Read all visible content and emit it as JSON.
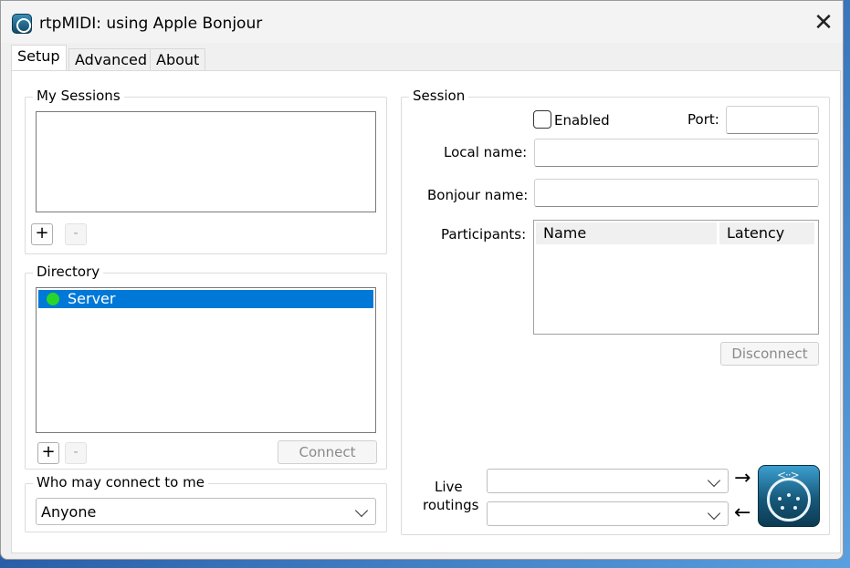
{
  "window": {
    "title": "rtpMIDI: using Apple Bonjour",
    "close_glyph": "✕"
  },
  "tabs": [
    {
      "label": "Setup",
      "active": true
    },
    {
      "label": "Advanced",
      "active": false
    },
    {
      "label": "About",
      "active": false
    }
  ],
  "my_sessions": {
    "title": "My Sessions",
    "items": [],
    "add_label": "+",
    "remove_label": "-"
  },
  "directory": {
    "title": "Directory",
    "items": [
      {
        "label": "Server",
        "selected": true,
        "status_color": "#2ad52a"
      }
    ],
    "add_label": "+",
    "remove_label": "-",
    "connect_label": "Connect"
  },
  "who_may_connect": {
    "title": "Who may connect to me",
    "value": "Anyone"
  },
  "session": {
    "title": "Session",
    "enabled_label": "Enabled",
    "enabled_checked": false,
    "port_label": "Port:",
    "port_value": "",
    "local_name_label": "Local name:",
    "local_name_value": "",
    "bonjour_name_label": "Bonjour name:",
    "bonjour_name_value": "",
    "participants_label": "Participants:",
    "participants_columns": [
      "Name",
      "Latency"
    ],
    "participants_rows": [],
    "disconnect_label": "Disconnect"
  },
  "live_routings": {
    "label_line1": "Live",
    "label_line2": "routings",
    "out_value": "",
    "in_value": "",
    "out_arrow": "→",
    "in_arrow": "←",
    "logo_arrows": "<··>",
    "logo_icon": "midi-connector-icon"
  },
  "colors": {
    "selection": "#0078d7",
    "status_online": "#2ad52a",
    "window_bg": "#f0f0f0"
  }
}
